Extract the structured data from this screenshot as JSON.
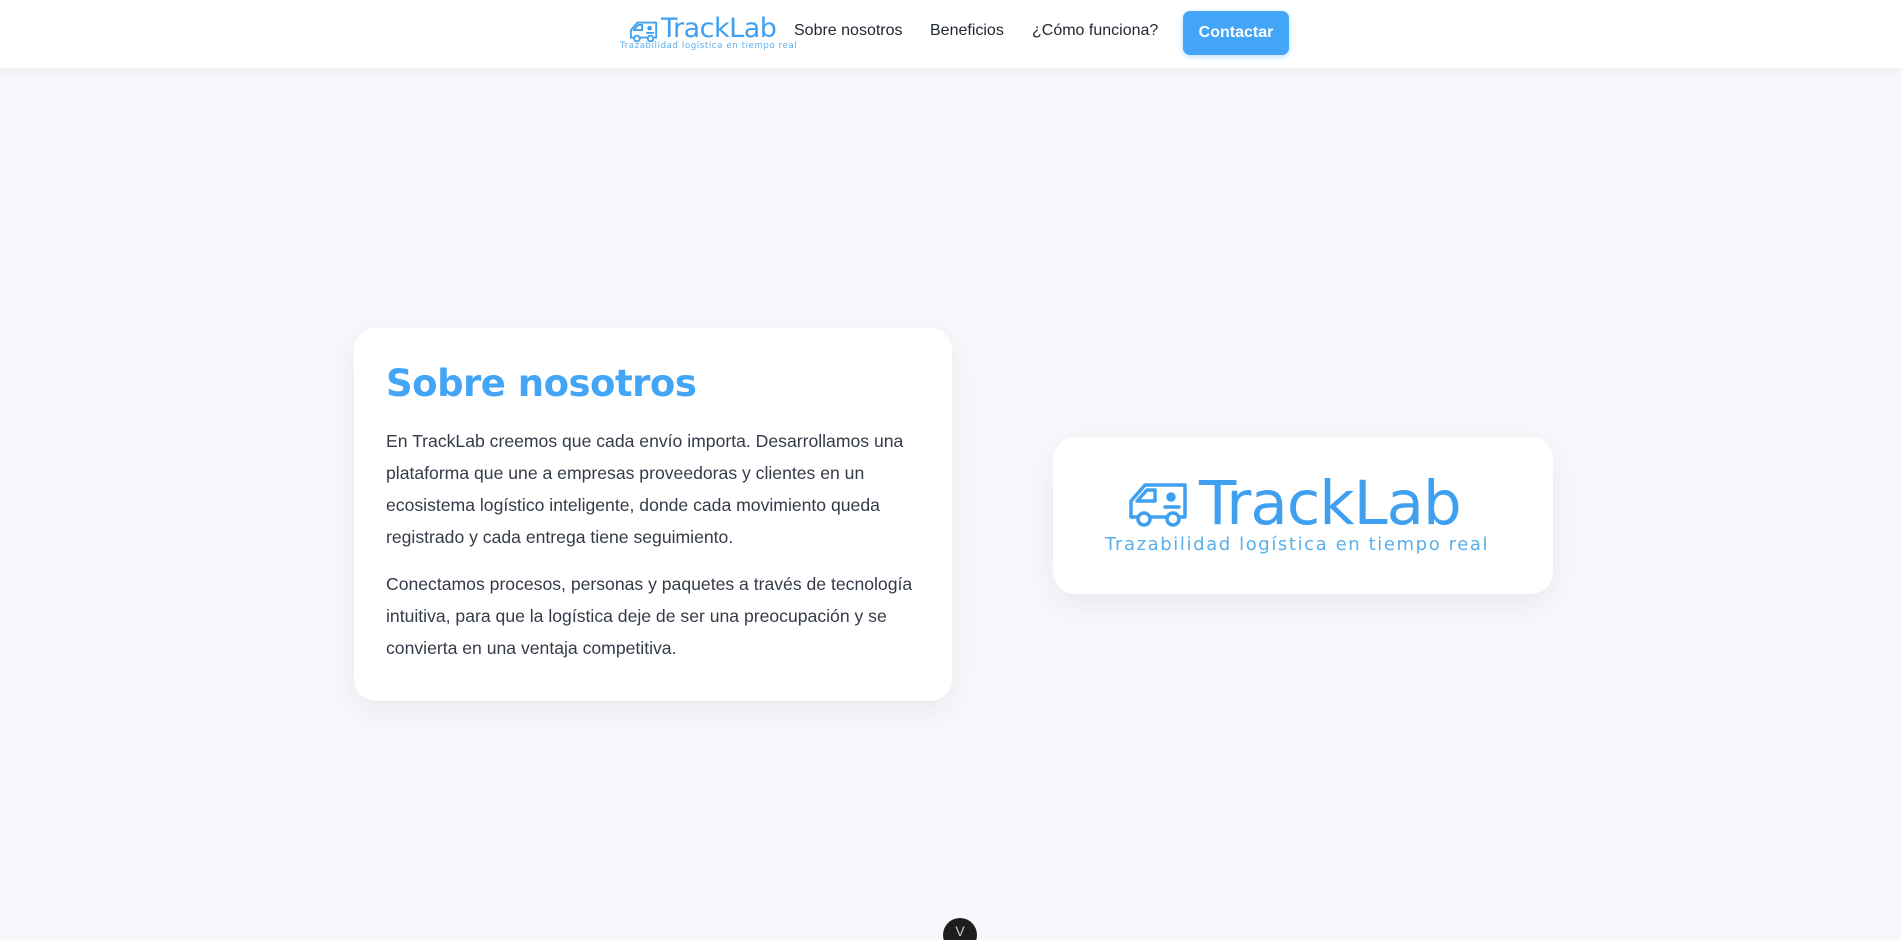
{
  "nav": {
    "brand": "TrackLab",
    "tagline": "Trazabilidad logística en tiempo real",
    "links": [
      "Sobre nosotros",
      "Beneficios",
      "¿Cómo funciona?"
    ],
    "cta": "Contactar"
  },
  "about": {
    "title": "Sobre nosotros",
    "paragraphs": [
      "En TrackLab creemos que cada envío importa. Desarrollamos una plataforma que une a empresas proveedoras y clientes en un ecosistema logístico inteligente, donde cada movimiento queda registrado y cada entrega tiene seguimiento.",
      "Conectamos procesos, personas y paquetes a través de tecnología intuitiva, para que la logística deje de ser una preocupación y se convierta en una ventaja competitiva."
    ]
  },
  "logo_card": {
    "brand": "TrackLab",
    "tagline": "Trazabilidad logística en tiempo real"
  },
  "badge": {
    "glyph": "V"
  },
  "colors": {
    "accent": "#42a5f5",
    "text": "#343b48",
    "background": "#f7f8fb"
  }
}
